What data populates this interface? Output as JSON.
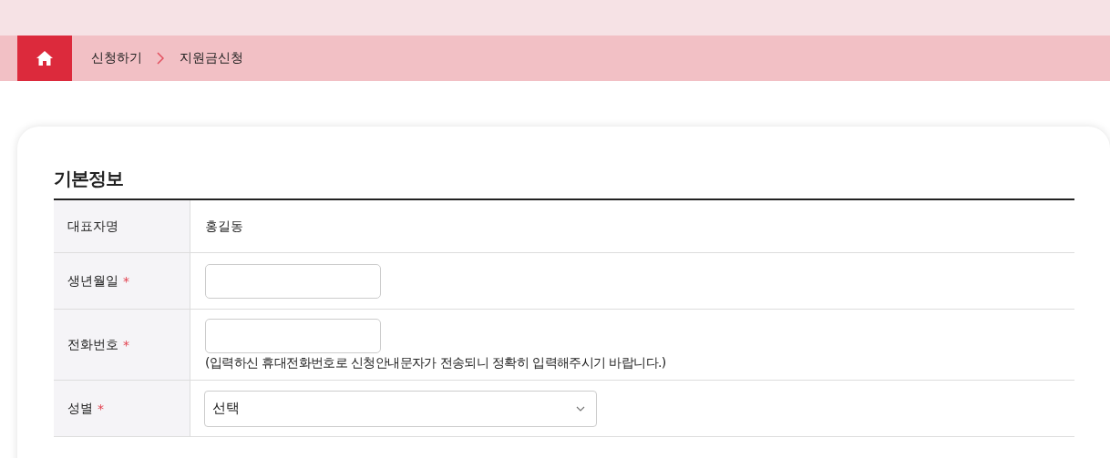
{
  "breadcrumb": [
    {
      "label": "신청하기"
    },
    {
      "label": "지원금신청"
    }
  ],
  "section_title": "기본정보",
  "rows": [
    {
      "label": "대표자명",
      "required": false,
      "kind": "text",
      "value": "홍길동"
    },
    {
      "label": "생년월일",
      "required": true,
      "kind": "input"
    },
    {
      "label": "전화번호",
      "required": true,
      "kind": "input",
      "note": "(입력하신 휴대전화번호로 신청안내문자가 전송되니 정확히 입력해주시기 바랍니다.)"
    },
    {
      "label": "성별",
      "required": true,
      "kind": "select",
      "value": "선택"
    }
  ],
  "required_mark": "*"
}
